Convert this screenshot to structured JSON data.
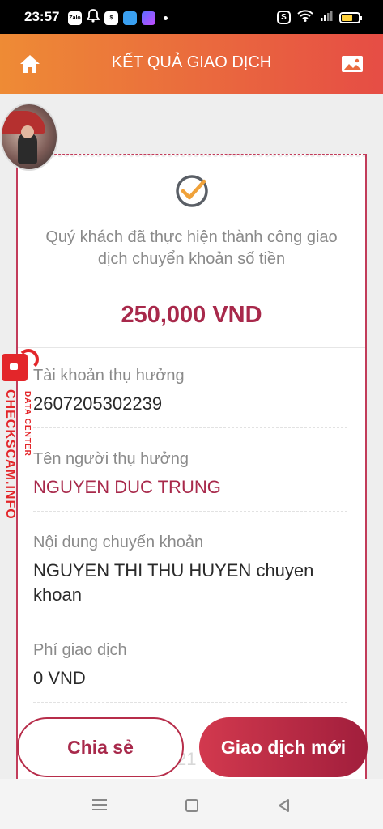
{
  "status_bar": {
    "time": "23:57",
    "app_icons": [
      "zalo-icon",
      "bell-icon",
      "shopee-icon",
      "app-icon",
      "app-icon-2"
    ]
  },
  "header": {
    "title": "KẾT QUẢ GIAO DỊCH",
    "home_icon": "home-icon",
    "image_icon": "image-icon",
    "gradient": [
      "#ee8b35",
      "#e64d45"
    ]
  },
  "result": {
    "message": "Quý khách đã thực hiện thành công giao dịch chuyển khoản số tiền",
    "amount": "250,000 VND",
    "accent_color": "#a8294b"
  },
  "details": [
    {
      "label": "Tài khoản thụ hưởng",
      "value": "2607205302239"
    },
    {
      "label": "Tên người thụ hưởng",
      "value": "NGUYEN DUC TRUNG"
    },
    {
      "label": "Nội dung chuyển khoản",
      "value": "NGUYEN THI THU HUYEN chuyen khoan"
    },
    {
      "label": "Phí giao dịch",
      "value": "0 VND"
    }
  ],
  "watermark": {
    "main": "CHECKSCAM.INFO",
    "sub": "DATA CENTER"
  },
  "partial_text": {
    "line1": "h",
    "line2": "21"
  },
  "actions": {
    "share_label": "Chia sẻ",
    "new_transaction_label": "Giao dịch mới"
  }
}
